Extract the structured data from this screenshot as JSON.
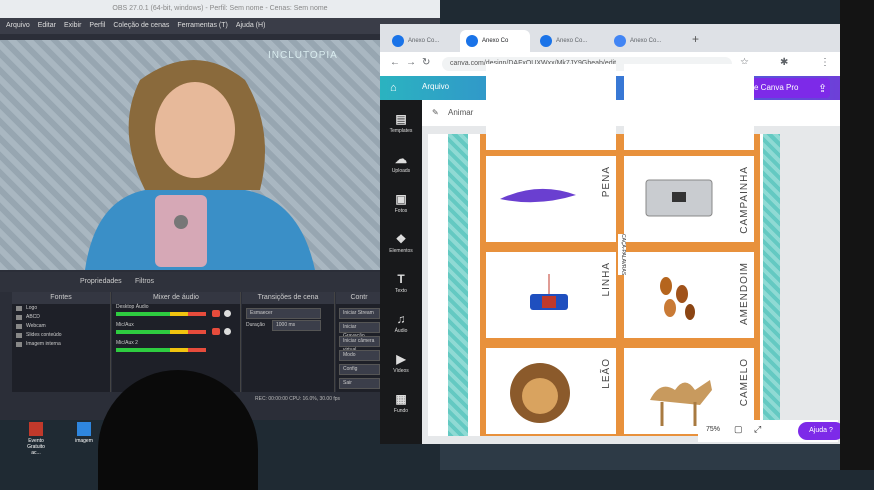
{
  "obs": {
    "title": "OBS 27.0.1 (64-bit, windows) - Perfil: Sem nome - Cenas: Sem nome",
    "menu": [
      "Arquivo",
      "Editar",
      "Exibir",
      "Perfil",
      "Coleção de cenas",
      "Ferramentas (T)",
      "Ajuda (H)"
    ],
    "brand": "INCLUTOPIA",
    "panel_labels": {
      "properties": "Propriedades",
      "filters": "Filtros"
    },
    "docks": {
      "sources": "Fontes",
      "mixer": "Mixer de áudio",
      "transitions": "Transições de cena",
      "controls": "Contr"
    },
    "sources": [
      "Logo",
      "ABCD",
      "Webcam",
      "Slides conteúdo",
      "Imagem interna"
    ],
    "mixer_channels": [
      "Desktop Áudio",
      "Mic/Aux",
      "Mic/Aux 2"
    ],
    "transition": {
      "type": "Esmaecer",
      "duration_label": "Duração",
      "duration_value": "1000 ms"
    },
    "controls": [
      "Iniciar Stream",
      "Iniciar Gravação",
      "Iniciar câmera virtual",
      "Modo",
      "Config",
      "Sair"
    ],
    "status": "REC: 00:00:00   CPU: 16.0%, 30.00 fps",
    "desktop_icons": [
      "Evento Gratuito ac...",
      "imagem"
    ]
  },
  "chrome": {
    "tabs": [
      "Anexo Co...",
      "Anexo Co",
      "Anexo Co...",
      "Anexo Co..."
    ],
    "new_tab": "+",
    "url": "canva.com/design/DAFxQUXWxx/Mk7JY9Gbeab/edit"
  },
  "canva": {
    "home": "Arquivo",
    "pro_button": "Experimente Canva Pro",
    "toolbar_label": "Animar",
    "sidebar": [
      "Templates",
      "Uploads",
      "Fotos",
      "Elementos",
      "Texto",
      "Áudio",
      "Vídeos",
      "Fundo"
    ],
    "cards": [
      "PENA",
      "CAMPAINHA",
      "LINHA",
      "AMENDOIM",
      "LEÃO",
      "CAMELO"
    ],
    "side_tag": "CAÇA-PALAVRAS",
    "zoom": "75%",
    "help": "Ajuda ?"
  },
  "colors": {
    "canva_purple": "#7d2ae8",
    "grid_orange": "#e8913c",
    "stripe_teal": "#64c9c2"
  },
  "icons": [
    "home-icon",
    "share-icon",
    "back-icon",
    "forward-icon",
    "reload-icon",
    "star-icon",
    "extensions-icon",
    "menu-icon"
  ]
}
